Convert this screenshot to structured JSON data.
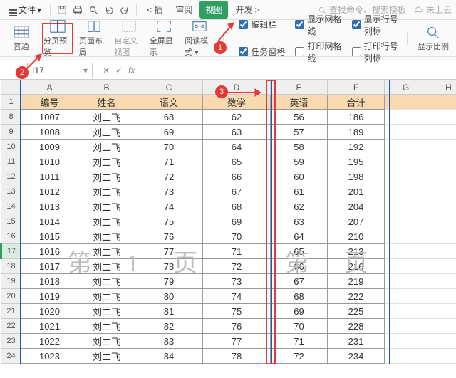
{
  "menubar": {
    "file_label": "文件",
    "tabs": [
      "插",
      "审阅",
      "视图",
      "开发"
    ],
    "active_tab_index": 2,
    "search_placeholder": "查找命令、搜索模板",
    "cloud_label": "未上云"
  },
  "ribbon": {
    "items": [
      {
        "label": "普通"
      },
      {
        "label": "分页预览"
      },
      {
        "label": "页面布局"
      },
      {
        "label": "自定义视图"
      },
      {
        "label": "全屏显示"
      },
      {
        "label": "阅读模式"
      }
    ],
    "checks": [
      {
        "label": "编辑栏",
        "checked": true
      },
      {
        "label": "显示网格线",
        "checked": true
      },
      {
        "label": "显示行号列标",
        "checked": true
      },
      {
        "label": "任务窗格",
        "checked": true
      },
      {
        "label": "打印网格线",
        "checked": false
      },
      {
        "label": "打印行号列标",
        "checked": false
      }
    ],
    "right_label": "显示比例"
  },
  "formula_bar": {
    "cell_ref": "I17",
    "fx_label": "fx"
  },
  "grid": {
    "col_letters": [
      "A",
      "B",
      "C",
      "D",
      "E",
      "F",
      "G",
      "H"
    ],
    "header_row": {
      "rownum": "1",
      "cells": [
        "编号",
        "姓名",
        "语文",
        "数学",
        "英语",
        "合计"
      ]
    },
    "current_row": 17,
    "rows": [
      {
        "rownum": "8",
        "cells": [
          "1007",
          "刘二飞",
          "68",
          "62",
          "56",
          "186"
        ]
      },
      {
        "rownum": "9",
        "cells": [
          "1008",
          "刘二飞",
          "69",
          "63",
          "57",
          "189"
        ]
      },
      {
        "rownum": "10",
        "cells": [
          "1009",
          "刘二飞",
          "70",
          "64",
          "58",
          "192"
        ]
      },
      {
        "rownum": "11",
        "cells": [
          "1010",
          "刘二飞",
          "71",
          "65",
          "59",
          "195"
        ]
      },
      {
        "rownum": "12",
        "cells": [
          "1011",
          "刘二飞",
          "72",
          "66",
          "60",
          "198"
        ]
      },
      {
        "rownum": "13",
        "cells": [
          "1012",
          "刘二飞",
          "73",
          "67",
          "61",
          "201"
        ]
      },
      {
        "rownum": "14",
        "cells": [
          "1013",
          "刘二飞",
          "74",
          "68",
          "62",
          "204"
        ]
      },
      {
        "rownum": "15",
        "cells": [
          "1014",
          "刘二飞",
          "75",
          "69",
          "63",
          "207"
        ]
      },
      {
        "rownum": "16",
        "cells": [
          "1015",
          "刘二飞",
          "76",
          "70",
          "64",
          "210"
        ]
      },
      {
        "rownum": "17",
        "cells": [
          "1016",
          "刘二飞",
          "77",
          "71",
          "65",
          "213"
        ]
      },
      {
        "rownum": "18",
        "cells": [
          "1017",
          "刘二飞",
          "78",
          "72",
          "66",
          "216"
        ]
      },
      {
        "rownum": "19",
        "cells": [
          "1018",
          "刘二飞",
          "79",
          "73",
          "67",
          "219"
        ]
      },
      {
        "rownum": "20",
        "cells": [
          "1019",
          "刘二飞",
          "80",
          "74",
          "68",
          "222"
        ]
      },
      {
        "rownum": "21",
        "cells": [
          "1020",
          "刘二飞",
          "81",
          "75",
          "69",
          "225"
        ]
      },
      {
        "rownum": "22",
        "cells": [
          "1021",
          "刘二飞",
          "82",
          "76",
          "70",
          "228"
        ]
      },
      {
        "rownum": "23",
        "cells": [
          "1022",
          "刘二飞",
          "83",
          "77",
          "71",
          "231"
        ]
      },
      {
        "rownum": "24",
        "cells": [
          "1023",
          "刘二飞",
          "84",
          "78",
          "72",
          "234"
        ]
      }
    ]
  },
  "watermarks": {
    "left": "第 1 页",
    "right": "第   页"
  },
  "annotations": {
    "b1": "1",
    "b2": "2",
    "b3": "3"
  }
}
